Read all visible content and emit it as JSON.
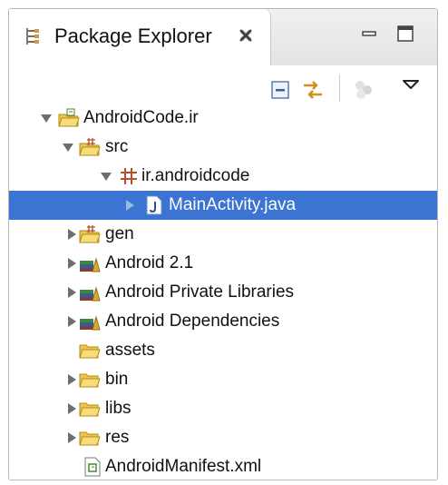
{
  "view": {
    "tab_title": "Package Explorer",
    "tab_icon": "package-explorer-icon",
    "close_icon": "close-x-icon"
  },
  "window_buttons": [
    "minimize-icon",
    "maximize-icon"
  ],
  "toolbar": {
    "icons": [
      "collapse-all-icon",
      "link-with-editor-icon",
      "focus-icon",
      "view-menu-icon"
    ]
  },
  "tree": [
    {
      "label": "AndroidCode.ir",
      "icon": "android-project-icon",
      "expanded": true,
      "depth": 0
    },
    {
      "label": "src",
      "icon": "source-folder-icon",
      "expanded": true,
      "depth": 1
    },
    {
      "label": "ir.androidcode",
      "icon": "package-icon",
      "expanded": true,
      "depth": 2
    },
    {
      "label": "MainActivity.java",
      "icon": "java-file-icon",
      "expanded": false,
      "depth": 3,
      "selected": true
    },
    {
      "label": "gen",
      "icon": "source-folder-icon",
      "expanded": false,
      "depth": 1
    },
    {
      "label": "Android 2.1",
      "icon": "library-icon",
      "expanded": false,
      "depth": 1
    },
    {
      "label": "Android Private Libraries",
      "icon": "library-icon",
      "expanded": false,
      "depth": 1
    },
    {
      "label": "Android Dependencies",
      "icon": "library-icon",
      "expanded": false,
      "depth": 1
    },
    {
      "label": "assets",
      "icon": "folder-icon",
      "expanded": null,
      "depth": 1
    },
    {
      "label": "bin",
      "icon": "folder-icon",
      "expanded": false,
      "depth": 1
    },
    {
      "label": "libs",
      "icon": "folder-icon",
      "expanded": false,
      "depth": 1
    },
    {
      "label": "res",
      "icon": "folder-icon",
      "expanded": false,
      "depth": 1
    },
    {
      "label": "AndroidManifest.xml",
      "icon": "xml-file-icon",
      "expanded": null,
      "depth": 1
    }
  ],
  "colors": {
    "selection": "#3b74d2",
    "folder": "#f0c64a",
    "package": "#b4502b"
  }
}
